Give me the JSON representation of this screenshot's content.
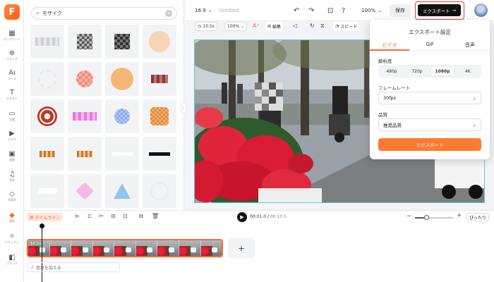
{
  "app": {
    "logo_letter": "F"
  },
  "rail": {
    "items": [
      {
        "icon": "▦",
        "label": "テンプレート"
      },
      {
        "icon": "⊕",
        "label": "メディア"
      },
      {
        "icon": "Aı",
        "label": "ツール"
      },
      {
        "icon": "T",
        "label": "テキスト"
      },
      {
        "icon": "▭",
        "label": "字幕"
      },
      {
        "icon": "▶",
        "label": "ビデオ"
      },
      {
        "icon": "▣",
        "label": "画像"
      },
      {
        "icon": "♫",
        "label": "音声"
      },
      {
        "icon": "◇",
        "label": "AI音声"
      },
      {
        "icon": "◆",
        "label": "素材"
      },
      {
        "icon": "✧",
        "label": "エフェクト"
      },
      {
        "icon": "◧",
        "label": "ブランド"
      }
    ]
  },
  "search": {
    "query": "モザイク",
    "icon": "search-icon"
  },
  "header": {
    "ratio": "16:9",
    "title": "Untitled",
    "zoom": "100%",
    "save_label": "保存",
    "export_label": "エクスポート",
    "export_arrow": "→"
  },
  "toolbar": {
    "duration": "10.5s",
    "scale": "100%",
    "edit_label": "編集",
    "speed_label": "スピード"
  },
  "export_panel": {
    "title": "エクスポート設定",
    "tabs": [
      "ビデオ",
      "GIF",
      "音声"
    ],
    "resolution_label": "解析度",
    "resolutions": [
      "480p",
      "720p",
      "1080p",
      "4K"
    ],
    "selected_resolution": "1080p",
    "framerate_label": "フレームレート",
    "framerate_value": "30fps",
    "quality_label": "品質",
    "quality_value": "推奨品質",
    "export_button": "エクスポート"
  },
  "timeline": {
    "chip_label": "タイムライン",
    "current_time": "00:01.0",
    "total_time": "00:10.5",
    "time_separator": " / ",
    "zoom_fraction": 0.3,
    "fit_label": "ぴったり",
    "clip_duration": "10.5s",
    "add_audio_label": "音声を加える",
    "add_clip_symbol": "+"
  },
  "colors": {
    "accent": "#ff6a2a",
    "export_highlight": "#e63a2e",
    "canvas_border": "#59d0d0"
  }
}
